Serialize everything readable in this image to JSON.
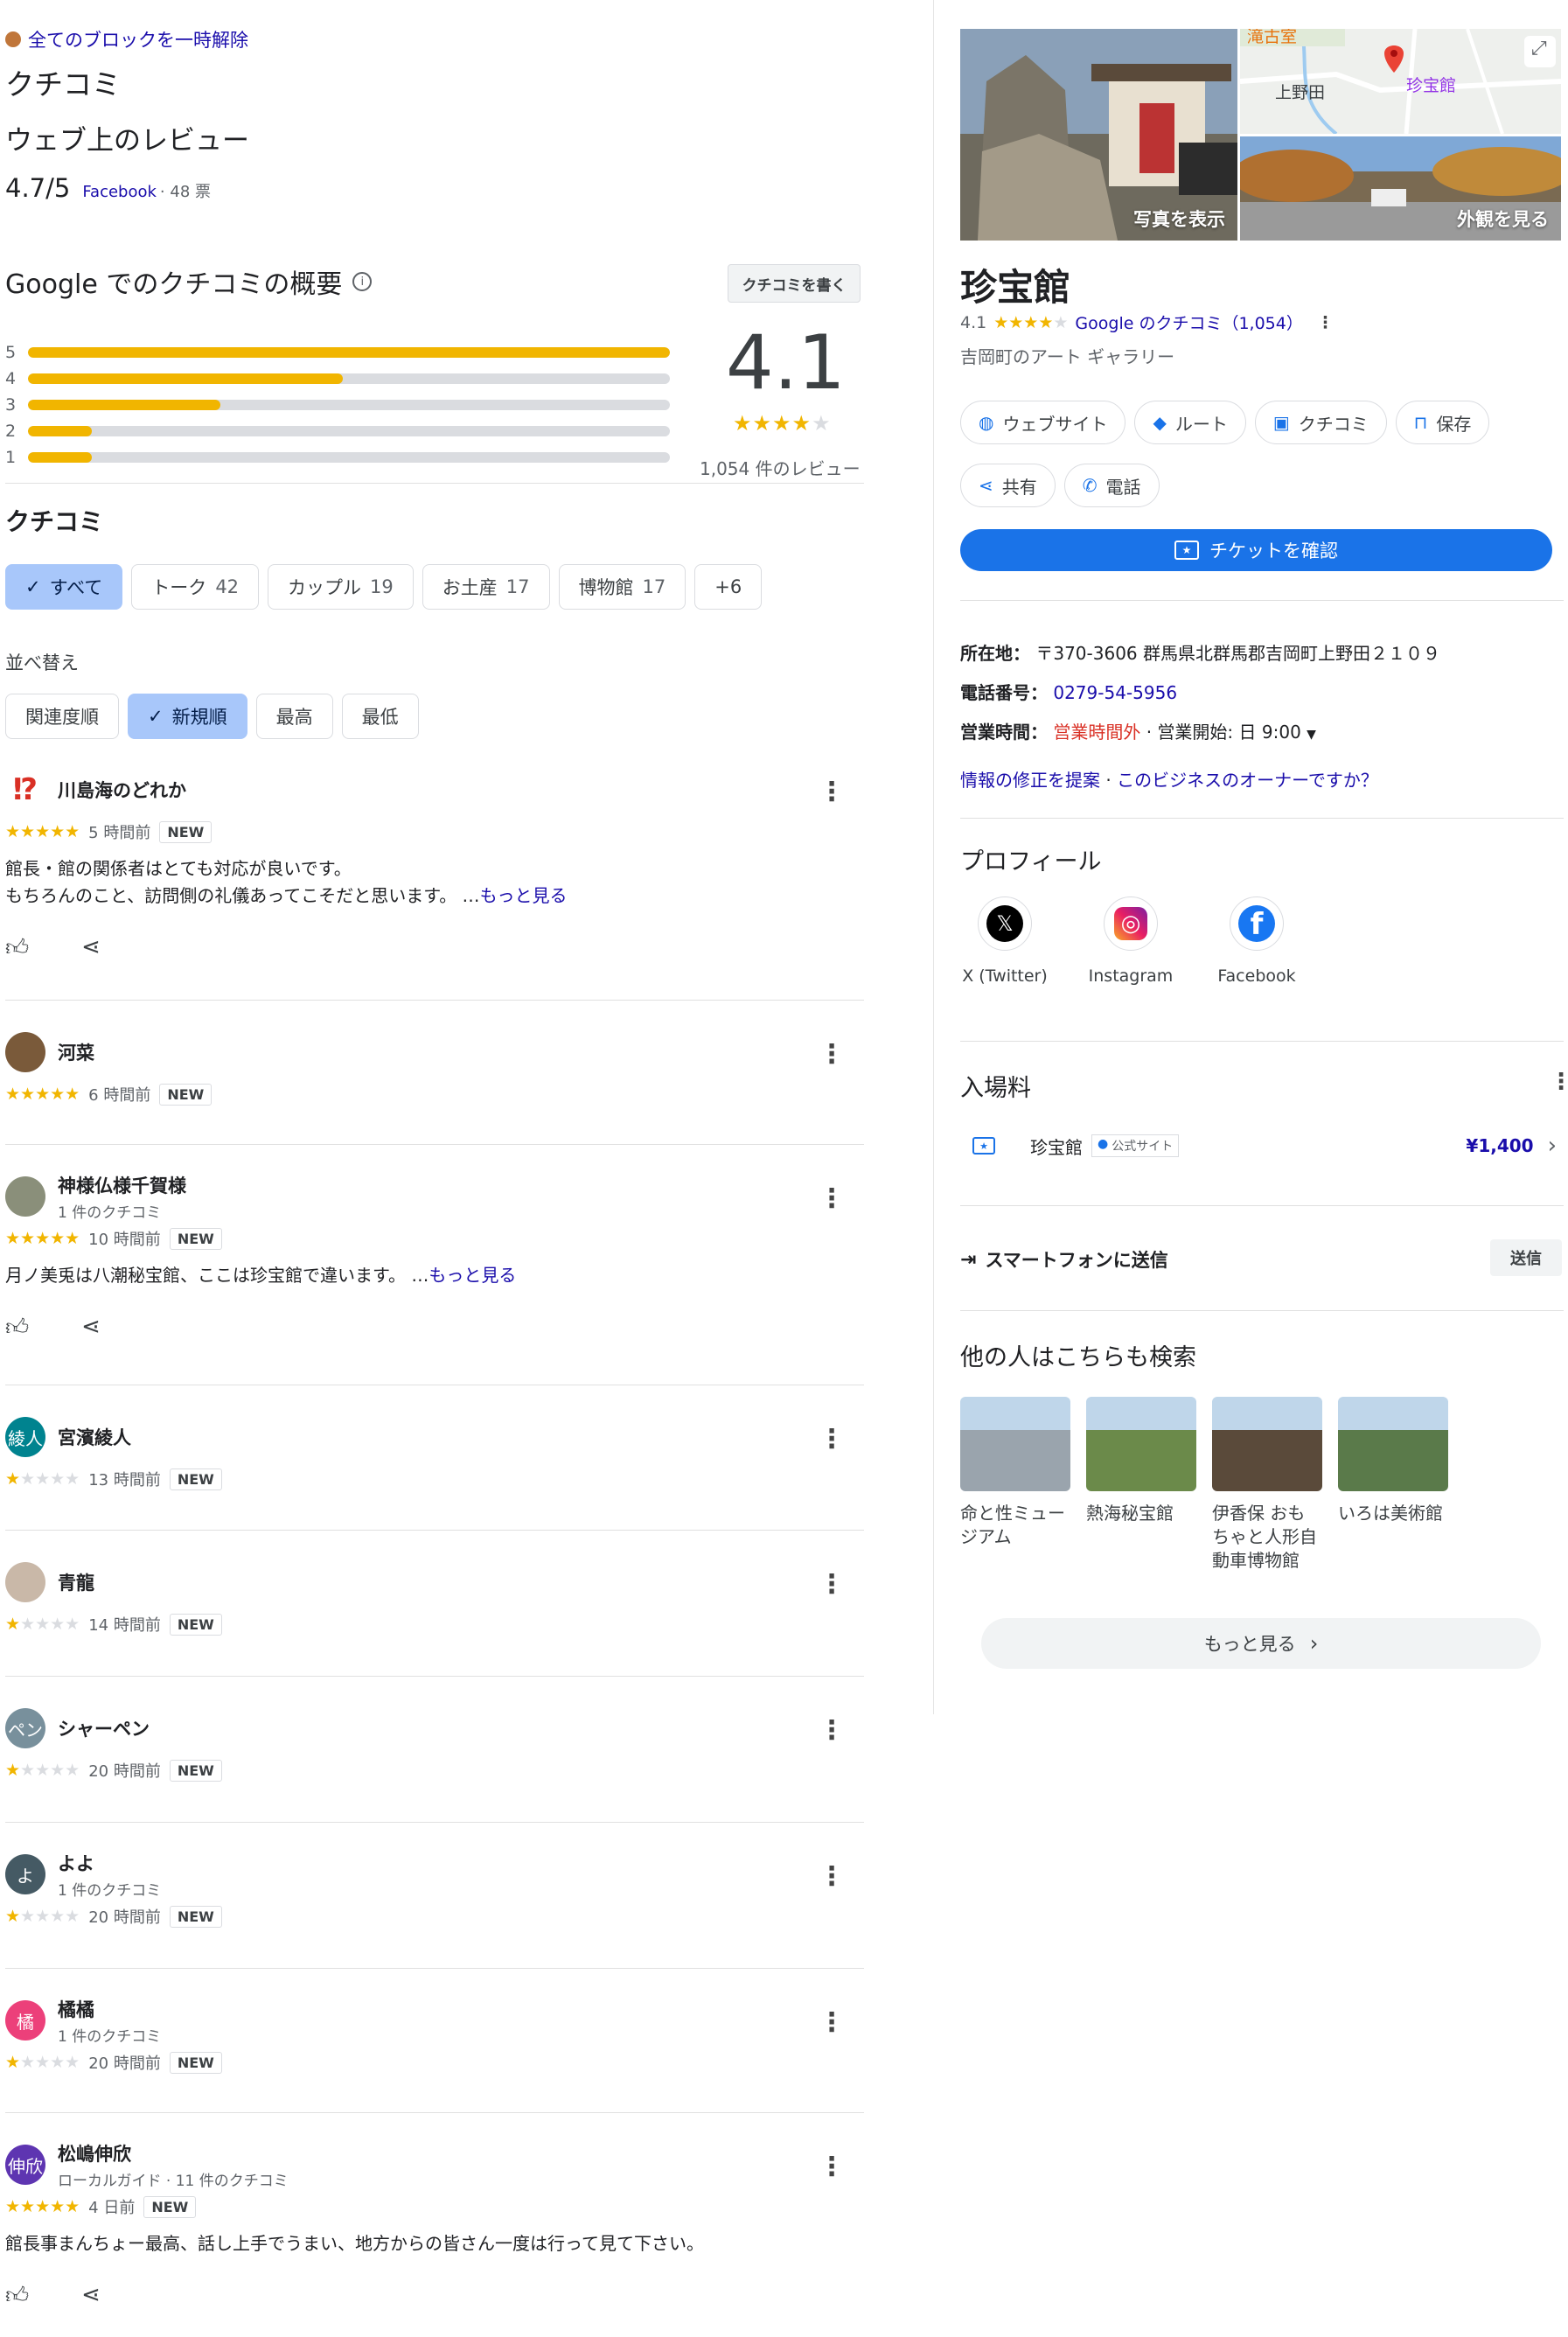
{
  "left": {
    "unblock": "全てのブロックを一時解除",
    "title": "クチコミ",
    "web_reviews_title": "ウェブ上のレビュー",
    "web_rating": {
      "score": "4.7/5",
      "source": "Facebook",
      "votes": "· 48 票"
    },
    "summary_title": "Google でのクチコミの概要",
    "info_icon": "i",
    "write_review": "クチコミを書く",
    "histogram": [
      {
        "star": "5",
        "fraction": 1.0
      },
      {
        "star": "4",
        "fraction": 0.49
      },
      {
        "star": "3",
        "fraction": 0.3
      },
      {
        "star": "2",
        "fraction": 0.1
      },
      {
        "star": "1",
        "fraction": 0.1
      }
    ],
    "overall_score": "4.1",
    "overall_stars": "★★★★",
    "overall_stars_off": "★",
    "overall_count": "1,054 件のレビュー",
    "reviews_heading": "クチコミ",
    "filters": [
      {
        "label": "すべて",
        "count": "",
        "check": "✓"
      },
      {
        "label": "トーク",
        "count": "42"
      },
      {
        "label": "カップル",
        "count": "19"
      },
      {
        "label": "お土産",
        "count": "17"
      },
      {
        "label": "博物館",
        "count": "17"
      },
      {
        "label": "+6",
        "count": ""
      }
    ],
    "sort_label": "並べ替え",
    "sorts": [
      {
        "label": "関連度順"
      },
      {
        "label": "新規順",
        "check": "✓"
      },
      {
        "label": "最高"
      },
      {
        "label": "最低"
      }
    ],
    "new_badge": "NEW",
    "more": "もっと見る",
    "reviews": [
      {
        "name": "川島海のどれか",
        "sub": "",
        "avatar_text": "⁉",
        "avatar_color": "#ffffff",
        "stars_on": "★★★★★",
        "stars_off": "",
        "time": "5 時間前",
        "text1": "館長・館の関係者はとても対応が良いです。",
        "text2": "もちろんのこと、訪問側の礼儀あってこそだと思います。 …"
      },
      {
        "name": "河菜",
        "sub": "",
        "avatar_text": "",
        "avatar_color": "#7a5a3a",
        "stars_on": "★★★★★",
        "stars_off": "",
        "time": "6 時間前"
      },
      {
        "name": "神様仏様千賀様",
        "sub": "1 件のクチコミ",
        "avatar_text": "",
        "avatar_color": "#8a8f7a",
        "stars_on": "★★★★★",
        "stars_off": "",
        "time": "10 時間前",
        "text1": "月ノ美兎は八潮秘宝館、ここは珍宝館で違います。 …"
      },
      {
        "name": "宮濱綾人",
        "sub": "",
        "avatar_text": "綾人",
        "avatar_color": "#00838f",
        "stars_on": "★",
        "stars_off": "★★★★",
        "time": "13 時間前"
      },
      {
        "name": "青龍",
        "sub": "",
        "avatar_text": "",
        "avatar_color": "#c9b8a8",
        "stars_on": "★",
        "stars_off": "★★★★",
        "time": "14 時間前"
      },
      {
        "name": "シャーペン",
        "sub": "",
        "avatar_text": "ペン",
        "avatar_color": "#78909c",
        "stars_on": "★",
        "stars_off": "★★★★",
        "time": "20 時間前"
      },
      {
        "name": "よよ",
        "sub": "1 件のクチコミ",
        "avatar_text": "よ",
        "avatar_color": "#455a64",
        "stars_on": "★",
        "stars_off": "★★★★",
        "time": "20 時間前"
      },
      {
        "name": "橘橘",
        "sub": "1 件のクチコミ",
        "avatar_text": "橘",
        "avatar_color": "#ec407a",
        "stars_on": "★",
        "stars_off": "★★★★",
        "time": "20 時間前"
      },
      {
        "name": "松嶋伸欣",
        "sub": "ローカルガイド · 11 件のクチコミ",
        "avatar_text": "伸欣",
        "avatar_color": "#5e35b1",
        "stars_on": "★★★★★",
        "stars_off": "",
        "time": "4 日前",
        "text1": "館長事まんちょー最高、話し上手でうまい、地方からの皆さん一度は行って見て下さい。"
      }
    ]
  },
  "right": {
    "photo_label": "写真を表示",
    "exterior_label": "外観を見る",
    "map_label_1": "上野田",
    "map_label_2": "珍宝館",
    "map_label_3": "滝古室",
    "name": "珍宝館",
    "rating": "4.1",
    "rating_stars": "★★★★",
    "rating_stars_off": "★",
    "rating_link": "Google のクチコミ（1,054）",
    "category": "吉岡町のアート ギャラリー",
    "actions_row1": [
      {
        "label": "ウェブサイト",
        "icon": "globe-icon"
      },
      {
        "label": "ルート",
        "icon": "directions-icon"
      },
      {
        "label": "クチコミ",
        "icon": "review-icon"
      },
      {
        "label": "保存",
        "icon": "bookmark-icon"
      }
    ],
    "actions_row2": [
      {
        "label": "共有",
        "icon": "share-icon"
      },
      {
        "label": "電話",
        "icon": "phone-icon"
      }
    ],
    "ticket": "チケットを確認",
    "address_label": "所在地：",
    "address": "〒370-3606 群馬県北群馬郡吉岡町上野田２１０９",
    "phone_label": "電話番号：",
    "phone": "0279-54-5956",
    "hours_label": "営業時間：",
    "hours_status": "営業時間外",
    "hours_next": "· 営業開始: 日 9:00",
    "suggest_edit": "情報の修正を提案",
    "owner": "このビジネスのオーナーですか？",
    "sep": " · ",
    "profile_title": "プロフィール",
    "profiles": [
      {
        "label": "X (Twitter)",
        "glyph": "𝕏"
      },
      {
        "label": "Instagram",
        "glyph": "◎"
      },
      {
        "label": "Facebook",
        "glyph": "f"
      }
    ],
    "admission_title": "入場料",
    "admission_name": "珍宝館",
    "admission_badge": "公式サイト",
    "admission_price": "¥1,400",
    "send_label": "スマートフォンに送信",
    "send_button": "送信",
    "others_title": "他の人はこちらも検索",
    "others": [
      {
        "name": "命と性ミュージアム",
        "color": "#9aa4ad"
      },
      {
        "name": "熱海秘宝館",
        "color": "#6b8a4a"
      },
      {
        "name": "伊香保 おもちゃと人形自動車博物館",
        "color": "#5a4a3a"
      },
      {
        "name": "いろは美術館",
        "color": "#5a7a4a"
      }
    ],
    "more_button": "もっと見る",
    "colors": {
      "accent": "#1a73e8",
      "star": "#f1b500",
      "link": "#1a0dab",
      "closed": "#d93025"
    }
  }
}
